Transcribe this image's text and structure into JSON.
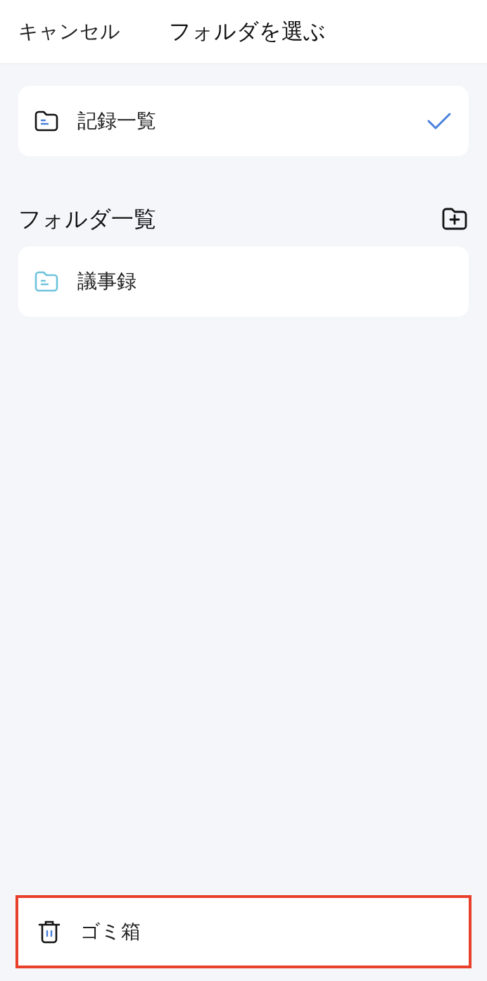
{
  "header": {
    "cancel": "キャンセル",
    "title": "フォルダを選ぶ"
  },
  "all_records": {
    "label": "記録一覧",
    "selected": true
  },
  "folders_section": {
    "title": "フォルダ一覧"
  },
  "folders": [
    {
      "label": "議事録",
      "color": "#6ec3dc",
      "selected": false
    }
  ],
  "trash": {
    "label": "ゴミ箱",
    "highlighted": true
  }
}
